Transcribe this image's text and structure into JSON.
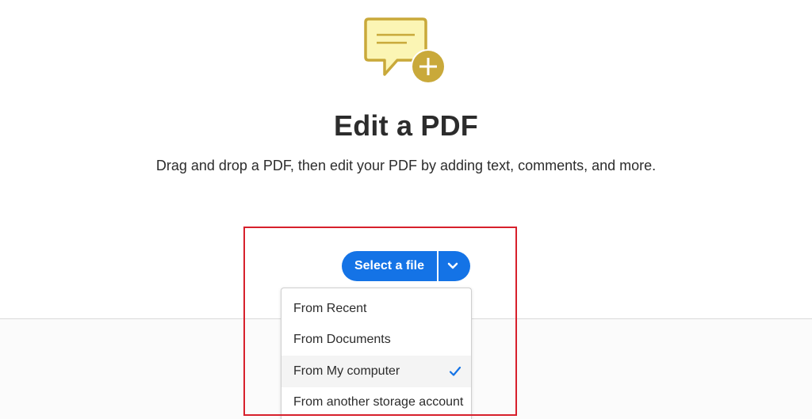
{
  "hero": {
    "icon": "comment-add-icon",
    "icon_colors": {
      "bubble_fill": "#fbf5b4",
      "bubble_stroke": "#c9a93a",
      "badge_fill": "#c9a93a"
    }
  },
  "header": {
    "title": "Edit a PDF",
    "subtitle": "Drag and drop a PDF, then edit your PDF by adding text, comments, and more."
  },
  "upload": {
    "select_label": "Select a file",
    "accent": "#1473e6",
    "dropdown_icon": "chevron-down-icon",
    "menu_items": [
      {
        "label": "From Recent",
        "selected": false
      },
      {
        "label": "From Documents",
        "selected": false
      },
      {
        "label": "From My computer",
        "selected": true
      },
      {
        "label": "From another storage account",
        "selected": false
      }
    ],
    "check_icon": "checkmark-icon"
  },
  "annotation": {
    "highlight_color": "#d7202c"
  }
}
